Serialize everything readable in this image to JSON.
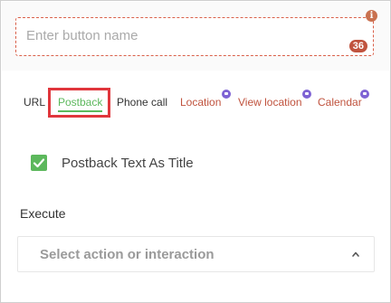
{
  "button_editor": {
    "name_field": {
      "placeholder": "Enter button name",
      "value": "",
      "char_count": "36"
    },
    "info_icon_glyph": "i",
    "tabs": [
      {
        "label": "URL",
        "state": "default"
      },
      {
        "label": "Postback",
        "state": "active"
      },
      {
        "label": "Phone call",
        "state": "default"
      },
      {
        "label": "Location",
        "state": "premium",
        "icon": "premium-badge-icon"
      },
      {
        "label": "View location",
        "state": "premium",
        "icon": "premium-badge-icon"
      },
      {
        "label": "Calendar",
        "state": "premium",
        "icon": "premium-badge-icon"
      }
    ],
    "postback_title_checkbox": {
      "label": "Postback Text As Title",
      "checked": true
    },
    "execute": {
      "label": "Execute",
      "select_placeholder": "Select action or interaction",
      "chevron": "chevron-up-icon"
    }
  },
  "colors": {
    "active_tab": "#5cb85c",
    "premium_tab": "#c0533e",
    "premium_badge": "#7e63d4",
    "highlight": "#e0363c",
    "field_border": "#d9604a"
  }
}
